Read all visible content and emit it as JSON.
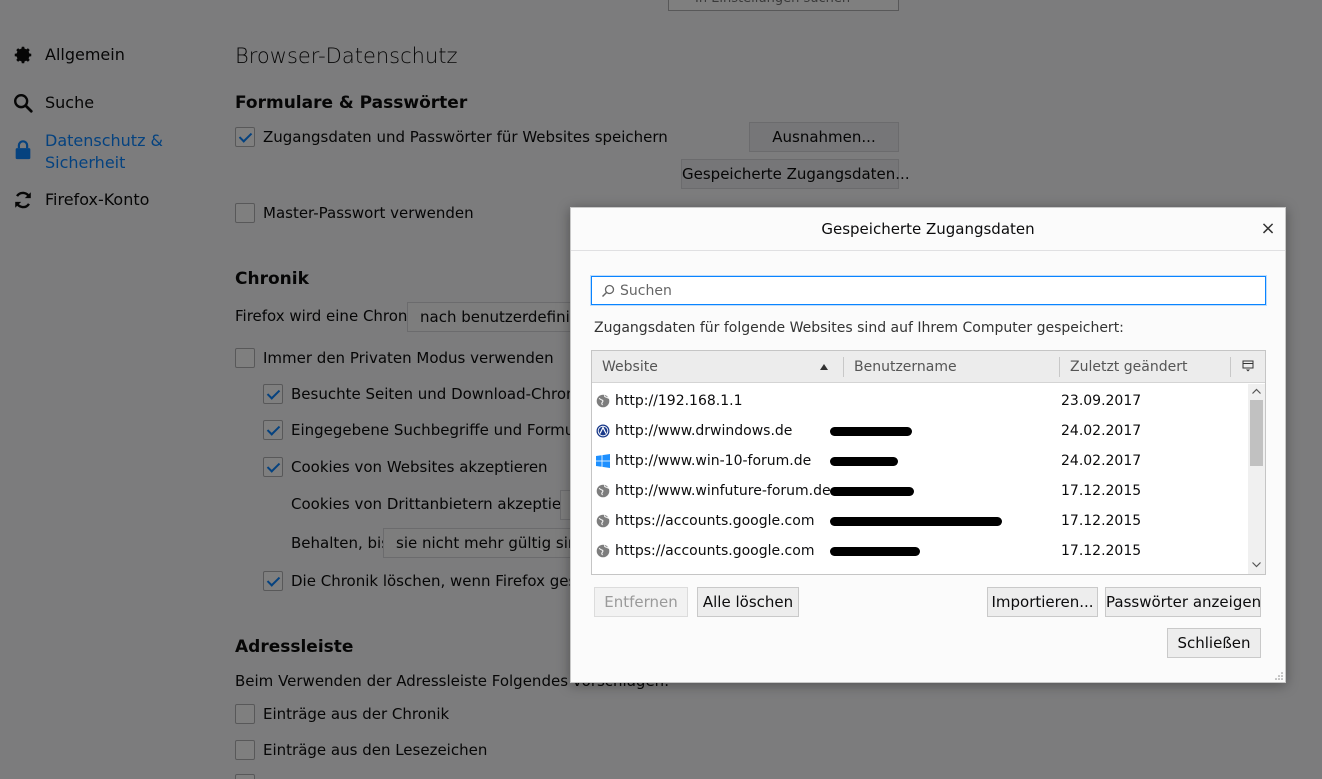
{
  "prefs": {
    "search_placeholder": "In Einstellungen suchen",
    "nav": [
      {
        "icon": "gear-icon",
        "label": "Allgemein"
      },
      {
        "icon": "search-icon",
        "label": "Suche"
      },
      {
        "icon": "lock-icon",
        "label": "Datenschutz & Sicherheit"
      },
      {
        "icon": "sync-icon",
        "label": "Firefox-Konto"
      }
    ],
    "page_title": "Browser-Datenschutz",
    "forms": {
      "heading": "Formulare & Passwörter",
      "save_logins_label": "Zugangsdaten und Passwörter für Websites speichern",
      "save_logins_checked": true,
      "exceptions_button": "Ausnahmen...",
      "saved_logins_button": "Gespeicherte Zugangsdaten...",
      "master_password_label": "Master-Passwort verwenden",
      "master_password_checked": false
    },
    "history": {
      "heading": "Chronik",
      "mode_label": "Firefox wird eine Chronik",
      "mode_value": "nach benutzerdefinierten Einstellungen anlegen",
      "private_mode_label": "Immer den Privaten Modus verwenden",
      "visited_label": "Besuchte Seiten und Download-Chronik speichern",
      "search_form_label": "Eingegebene Suchbegriffe und Formulardaten speichern",
      "cookies_label": "Cookies von Websites akzeptieren",
      "third_party_label": "Cookies von Drittanbietern akzeptieren:",
      "keep_label": "Behalten, bis",
      "keep_value": "sie nicht mehr gültig sind",
      "clear_on_close_label": "Die Chronik löschen, wenn Firefox geschlossen wird"
    },
    "addressbar": {
      "heading": "Adressleiste",
      "description": "Beim Verwenden der Adressleiste Folgendes vorschlagen:",
      "history_label": "Einträge aus der Chronik",
      "bookmarks_label": "Einträge aus den Lesezeichen"
    }
  },
  "dialog": {
    "title": "Gespeicherte Zugangsdaten",
    "close_label": "×",
    "search_placeholder": "Suchen",
    "description": "Zugangsdaten für folgende Websites sind auf Ihrem Computer gespeichert:",
    "columns": {
      "website": "Website",
      "username": "Benutzername",
      "changed": "Zuletzt geändert"
    },
    "rows": [
      {
        "site": "http://192.168.1.1",
        "favicon": "globe-icon",
        "date": "23.09.2017",
        "redacted": false
      },
      {
        "site": "http://www.drwindows.de",
        "favicon": "drwindows-favicon",
        "date": "24.02.2017",
        "redacted": true
      },
      {
        "site": "http://www.win-10-forum.de",
        "favicon": "windows-favicon",
        "date": "24.02.2017",
        "redacted": true
      },
      {
        "site": "http://www.winfuture-forum.de",
        "favicon": "globe-icon",
        "date": "17.12.2015",
        "redacted": true
      },
      {
        "site": "https://accounts.google.com",
        "favicon": "globe-icon",
        "date": "17.12.2015",
        "redacted": true
      },
      {
        "site": "https://accounts.google.com",
        "favicon": "globe-icon",
        "date": "17.12.2015",
        "redacted": true
      }
    ],
    "buttons": {
      "remove": "Entfernen",
      "remove_all": "Alle löschen",
      "import": "Importieren...",
      "show_passwords": "Passwörter anzeigen",
      "close": "Schließen"
    }
  },
  "colors": {
    "accent": "#0a84ff",
    "overlay": "rgba(0,0,0,0.5)"
  }
}
